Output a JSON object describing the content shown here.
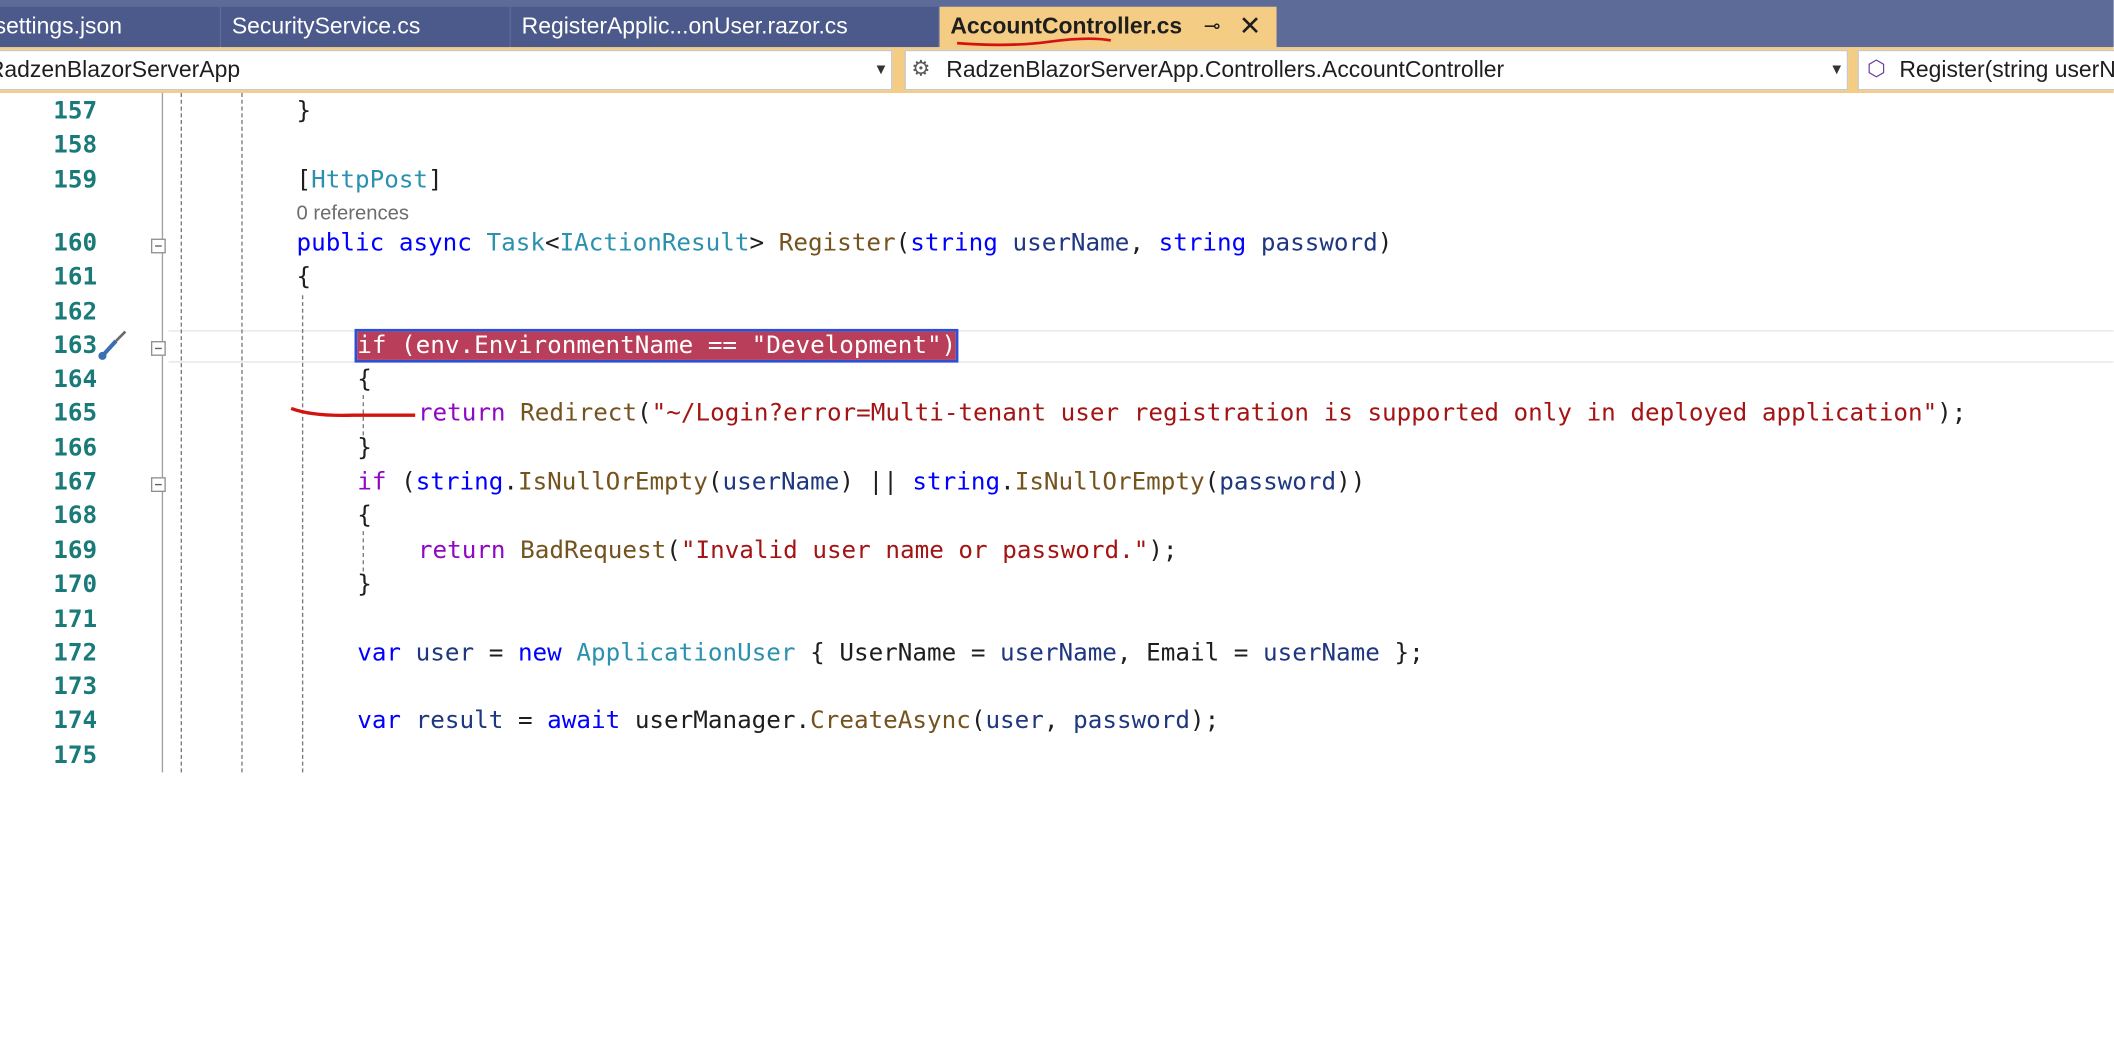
{
  "tabs": [
    {
      "label": "settings.json",
      "active": false
    },
    {
      "label": "SecurityService.cs",
      "active": false
    },
    {
      "label": "RegisterApplic...onUser.razor.cs",
      "active": false
    },
    {
      "label": "AccountController.cs",
      "active": true
    }
  ],
  "nav": {
    "project": "RadzenBlazorServerApp",
    "type": "RadzenBlazorServerApp.Controllers.AccountController",
    "member": "Register(string userN"
  },
  "editor": {
    "line_numbers": [
      "157",
      "158",
      "159",
      "160",
      "161",
      "162",
      "163",
      "164",
      "165",
      "166",
      "167",
      "168",
      "169",
      "170",
      "171",
      "172",
      "173",
      "174",
      "175"
    ],
    "references_label": "0 references",
    "code": {
      "l157": "}",
      "l159_attr": "HttpPost",
      "l160": [
        "public",
        " ",
        "async",
        " ",
        "Task",
        "<",
        "IActionResult",
        "> ",
        "Register",
        "(",
        "string",
        " ",
        "userName",
        ", ",
        "string",
        " ",
        "password",
        ")"
      ],
      "l161": "{",
      "l163": "if (env.EnvironmentName == \"Development\")",
      "l164": "{",
      "l165": [
        "return",
        " ",
        "Redirect",
        "(",
        "\"~/Login?error=Multi-tenant user registration is supported only in deployed application\"",
        ");"
      ],
      "l166": "}",
      "l167": [
        "if",
        " (",
        "string",
        ".",
        "IsNullOrEmpty",
        "(",
        "userName",
        ") || ",
        "string",
        ".",
        "IsNullOrEmpty",
        "(",
        "password",
        "))"
      ],
      "l168": "{",
      "l169": [
        "return",
        " ",
        "BadRequest",
        "(",
        "\"Invalid user name or password.\"",
        ");"
      ],
      "l170": "}",
      "l172": [
        "var",
        " ",
        "user",
        " = ",
        "new",
        " ",
        "ApplicationUser",
        " { UserName = ",
        "userName",
        ", Email = ",
        "userName",
        " };"
      ],
      "l174": [
        "var",
        " ",
        "result",
        " = ",
        "await",
        " userManager.",
        "CreateAsync",
        "(",
        "user",
        ", ",
        "password",
        ");"
      ]
    }
  }
}
